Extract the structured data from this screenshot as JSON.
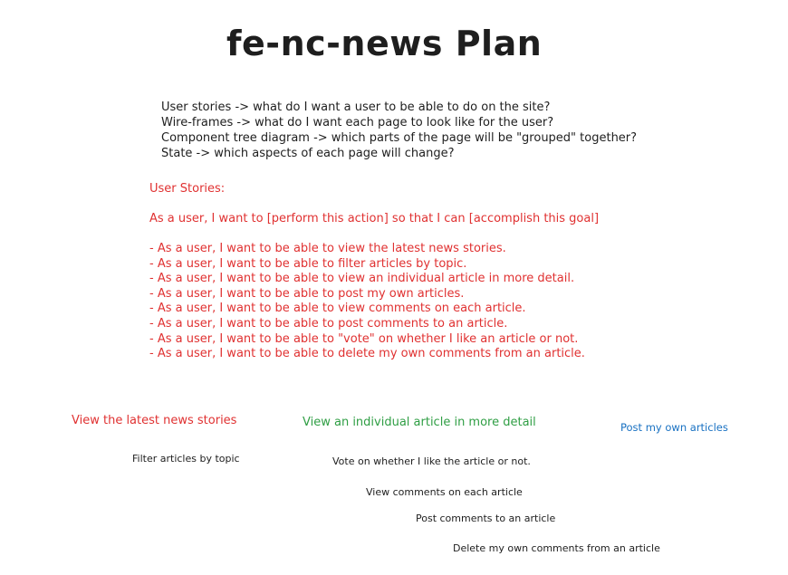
{
  "title": "fe-nc-news Plan",
  "planning_steps": [
    "User stories -> what do I want a user to be able to do on the site?",
    "Wire-frames -> what do I want each page to look like for the user?",
    "Component tree diagram -> which parts of the page will be \"grouped\" together?",
    "State -> which aspects of each page will change?"
  ],
  "user_stories": {
    "heading": "User Stories:",
    "template": "As a user, I want to [perform this action] so that I can [accomplish this goal]",
    "items": [
      "- As a user, I want to be able to view the latest news stories.",
      "- As a user, I want to be able to filter articles by topic.",
      "- As a user, I want to be able to view an individual article in more detail.",
      "- As a user, I want to be able to post my own articles.",
      "- As a user, I want to be able to view comments on each article.",
      "- As a user, I want to be able to post comments to an article.",
      "- As a user, I want to be able to \"vote\" on whether I like an article or not.",
      "- As a user, I want to be able to delete my own comments from an article."
    ]
  },
  "feature_labels": {
    "latest": "View the latest news stories",
    "individual": "View an individual article in more detail",
    "post_own": "Post my own articles",
    "filter": "Filter articles by topic",
    "vote": "Vote on whether I like the article or not.",
    "view_comments": "View comments on each article",
    "post_comments": "Post comments to an article",
    "delete_comments": "Delete my own comments from an article"
  },
  "colors": {
    "text": "#1e1e1e",
    "red": "#e03131",
    "green": "#2f9e44",
    "blue": "#1971c2",
    "background": "#ffffff"
  }
}
